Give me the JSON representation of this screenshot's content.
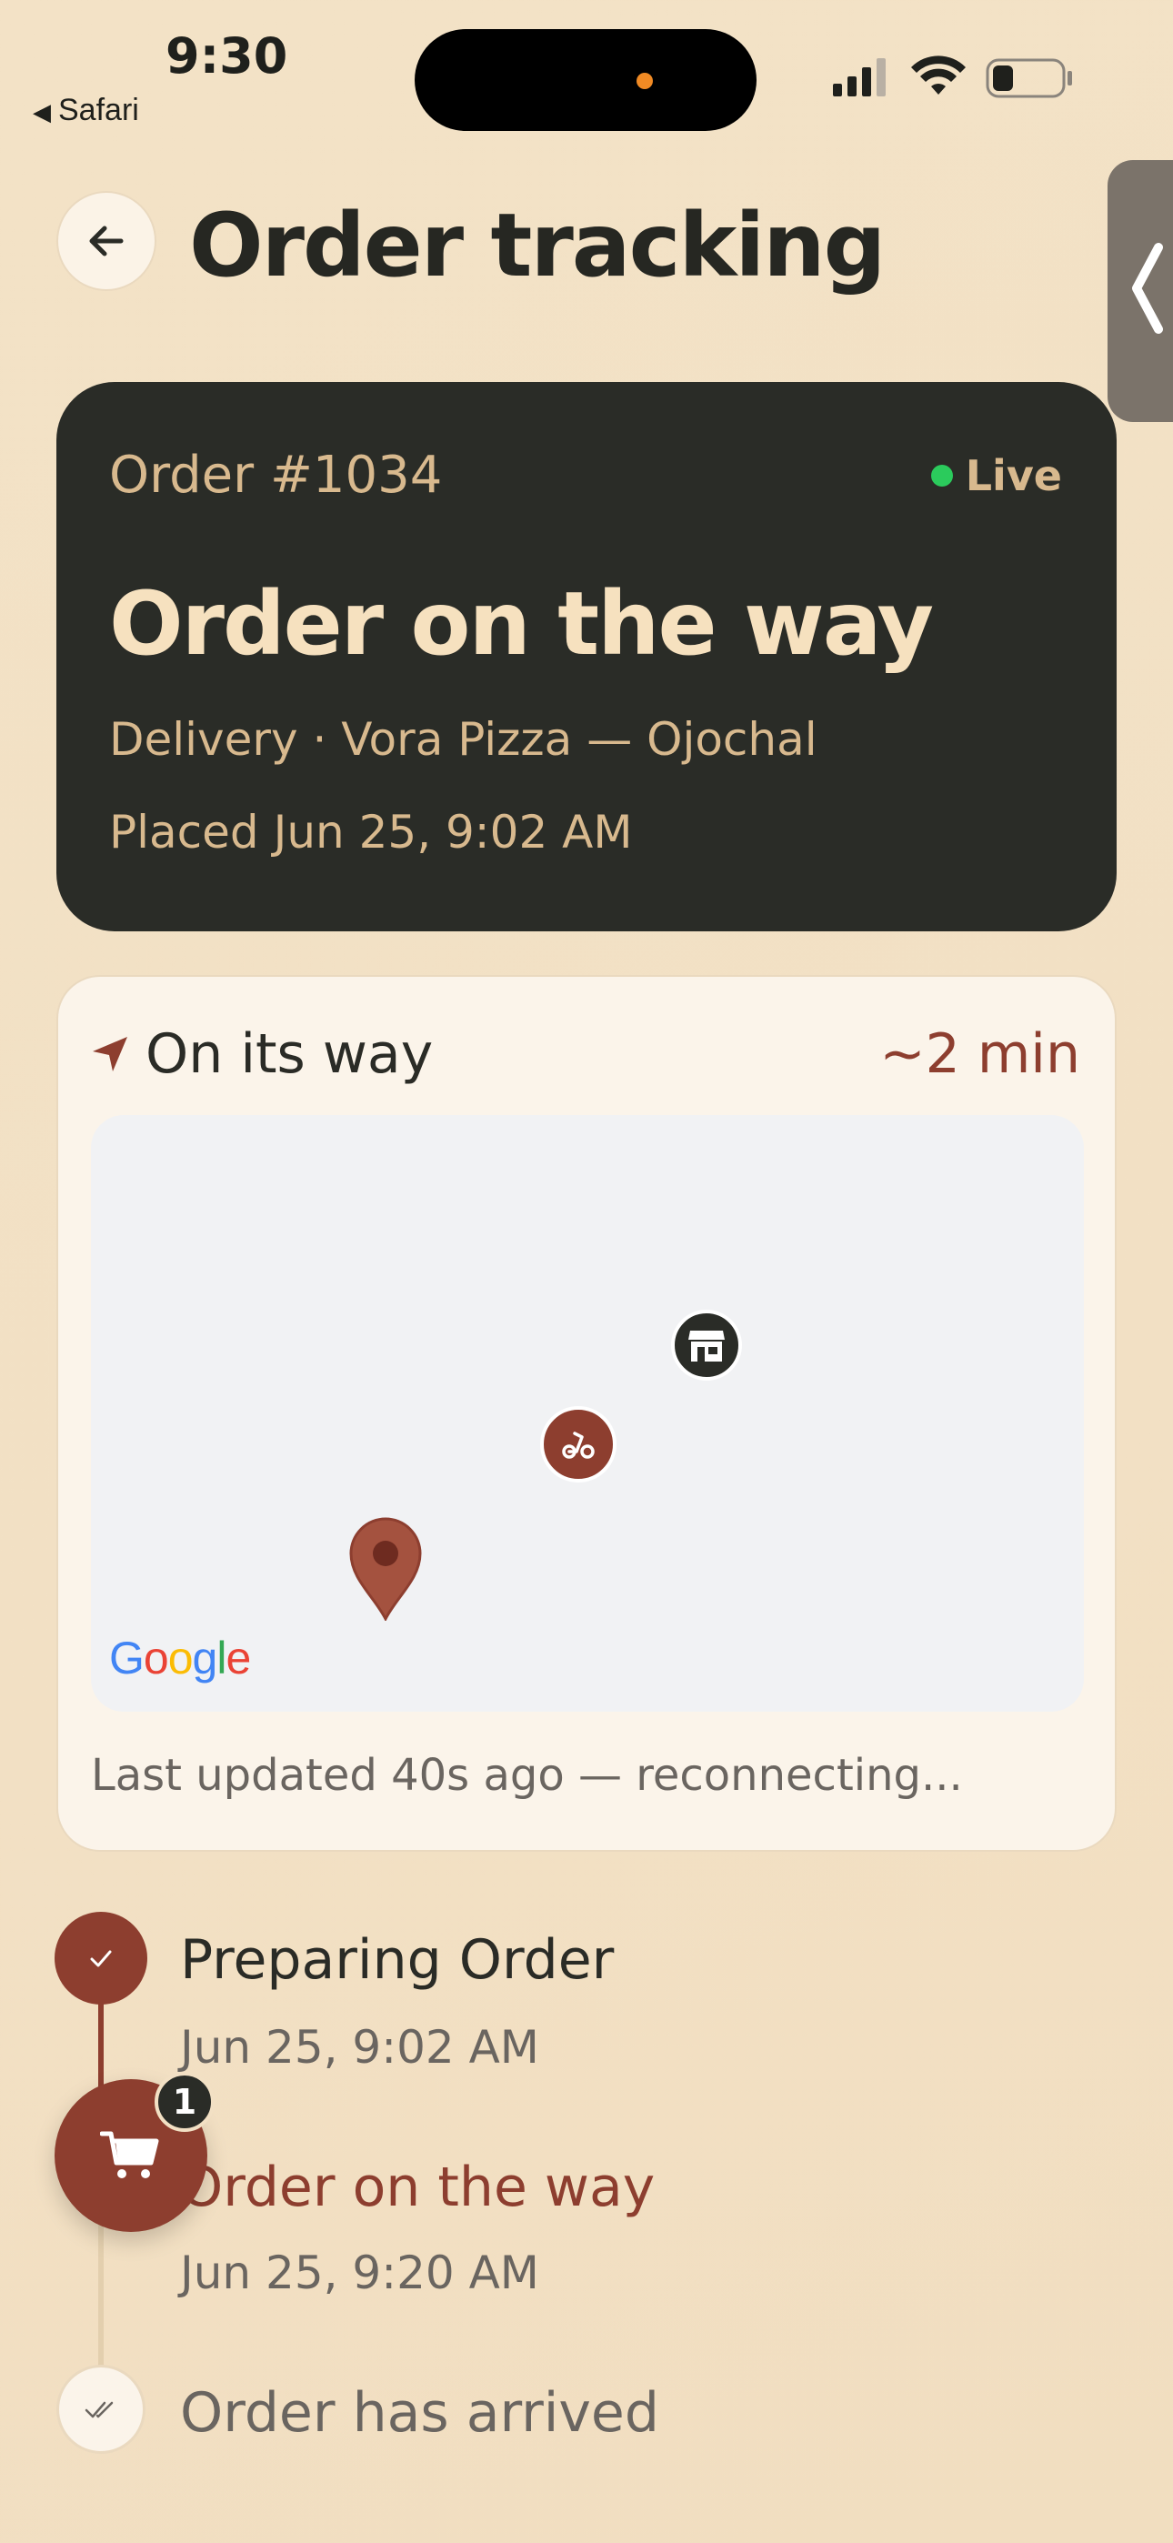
{
  "status_bar": {
    "time": "9:30",
    "back_app": "Safari"
  },
  "header": {
    "title": "Order tracking"
  },
  "order": {
    "number": "Order #1034",
    "live_label": "Live",
    "status_title": "Order on the way",
    "meta": "Delivery · Vora Pizza — Ojochal",
    "placed": "Placed Jun 25, 9:02 AM"
  },
  "tracking": {
    "heading": "On its way",
    "eta": "~2 min",
    "map_attribution": [
      "G",
      "o",
      "o",
      "g",
      "l",
      "e"
    ],
    "last_updated": "Last updated 40s ago — reconnecting..."
  },
  "timeline": [
    {
      "title": "Preparing Order",
      "time": "Jun 25, 9:02 AM",
      "state": "done"
    },
    {
      "title": "Order on the way",
      "time": "Jun 25, 9:20 AM",
      "state": "current"
    },
    {
      "title": "Order has arrived",
      "time": "",
      "state": "pending"
    }
  ],
  "cart": {
    "count": "1"
  },
  "colors": {
    "background": "#f2e0c4",
    "card_dark": "#2a2c27",
    "accent": "#8d3e2f",
    "live_green": "#2bcb5c",
    "muted_gold": "#d8b98e"
  },
  "icons": {
    "back": "arrow-left-icon",
    "navigation": "navigation-arrow-icon",
    "store": "store-icon",
    "rider": "scooter-icon",
    "destination": "map-pin-icon",
    "cart": "shopping-cart-icon",
    "check": "check-icon"
  }
}
